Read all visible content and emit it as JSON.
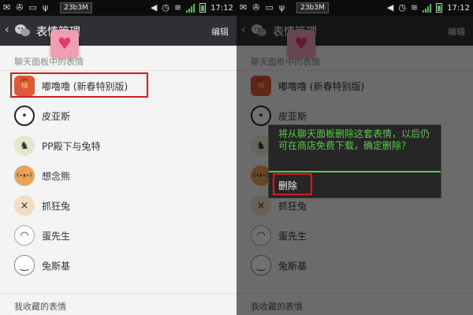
{
  "status": {
    "speed": "23b3M",
    "time": "17:12"
  },
  "header": {
    "title": "表情管理",
    "edit_label": "编辑"
  },
  "list": {
    "section_label": "聊天面板中的表情",
    "items": [
      {
        "label": "嘟噜噜 (新春特别版)",
        "glyph": "福"
      },
      {
        "label": "皮亚斯",
        "glyph": "•"
      },
      {
        "label": "PP殿下与兔特",
        "glyph": "♞"
      },
      {
        "label": "想念熊",
        "glyph": "ʕ•ᴥ•ʔ"
      },
      {
        "label": "抓狂兔",
        "glyph": "×"
      },
      {
        "label": "蛋先生",
        "glyph": "◠"
      },
      {
        "label": "兔斯基",
        "glyph": "‿"
      }
    ],
    "bottom_label": "我收藏的表情"
  },
  "dialog": {
    "message": "将从聊天面板删除这套表情，以后仍可在商店免费下载，确定删除？",
    "delete_label": "删除"
  },
  "colors": {
    "titlebar": "#2e3033",
    "accent": "#5fc552",
    "highlight": "#cc1f1f"
  },
  "icons": {
    "back": "back-arrow-icon",
    "wechat": "wechat-logo-icon",
    "heart": "heart-icon",
    "status": [
      "messages-icon",
      "wifi-icon",
      "signal-icon",
      "battery-icon"
    ]
  }
}
